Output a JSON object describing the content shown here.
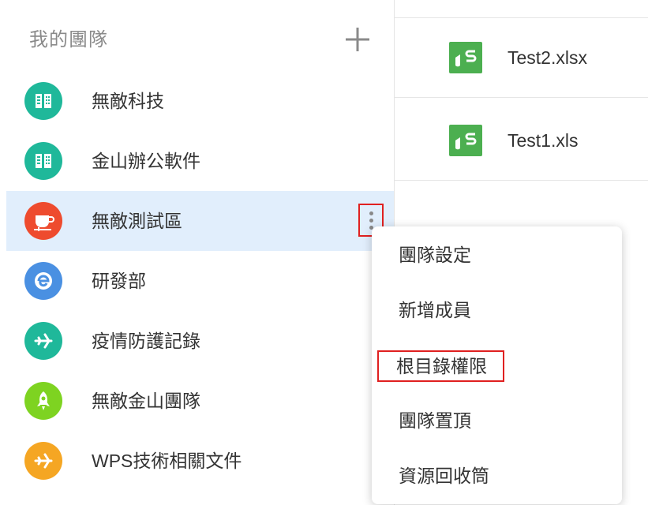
{
  "sidebar": {
    "title": "我的團隊",
    "add_icon": "plus-icon",
    "teams": [
      {
        "name": "無敵科技",
        "icon": "building-icon",
        "color": "#1fb89a"
      },
      {
        "name": "金山辦公軟件",
        "icon": "building-icon",
        "color": "#1fb89a"
      },
      {
        "name": "無敵測試區",
        "icon": "coffee-cup-icon",
        "color": "#ee4b2e",
        "selected": true
      },
      {
        "name": "研發部",
        "icon": "globe-icon",
        "color": "#4a90e2"
      },
      {
        "name": "疫情防護記錄",
        "icon": "airplane-icon",
        "color": "#1fb89a"
      },
      {
        "name": "無敵金山團隊",
        "icon": "rocket-icon",
        "color": "#7ed321"
      },
      {
        "name": "WPS技術相關文件",
        "icon": "airplane-icon",
        "color": "#f5a623"
      }
    ],
    "more_icon": "more-vertical-icon"
  },
  "files": [
    {
      "name": "Test2.xlsx",
      "icon": "spreadsheet-icon",
      "color": "#4caf50"
    },
    {
      "name": "Test1.xls",
      "icon": "spreadsheet-icon",
      "color": "#4caf50"
    }
  ],
  "context_menu": {
    "items": [
      {
        "label": "團隊設定"
      },
      {
        "label": "新增成員"
      },
      {
        "label": "根目錄權限",
        "highlighted": true
      },
      {
        "label": "團隊置頂"
      },
      {
        "label": "資源回收筒"
      }
    ]
  },
  "colors": {
    "selected_row": "#e1eefc",
    "highlight_border": "#e02020"
  }
}
